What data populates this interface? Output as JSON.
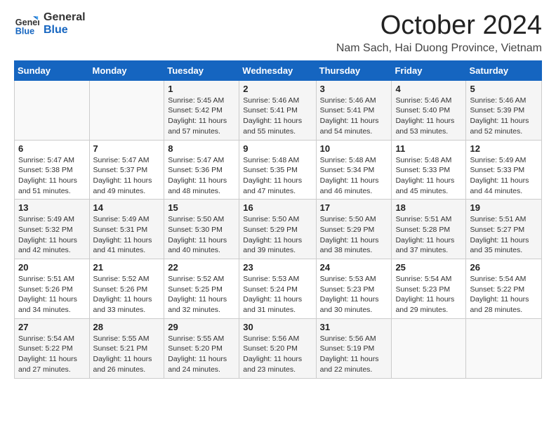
{
  "logo": {
    "line1": "General",
    "line2": "Blue"
  },
  "title": "October 2024",
  "subtitle": "Nam Sach, Hai Duong Province, Vietnam",
  "headers": [
    "Sunday",
    "Monday",
    "Tuesday",
    "Wednesday",
    "Thursday",
    "Friday",
    "Saturday"
  ],
  "weeks": [
    [
      {
        "day": "",
        "sunrise": "",
        "sunset": "",
        "daylight": ""
      },
      {
        "day": "",
        "sunrise": "",
        "sunset": "",
        "daylight": ""
      },
      {
        "day": "1",
        "sunrise": "Sunrise: 5:45 AM",
        "sunset": "Sunset: 5:42 PM",
        "daylight": "Daylight: 11 hours and 57 minutes."
      },
      {
        "day": "2",
        "sunrise": "Sunrise: 5:46 AM",
        "sunset": "Sunset: 5:41 PM",
        "daylight": "Daylight: 11 hours and 55 minutes."
      },
      {
        "day": "3",
        "sunrise": "Sunrise: 5:46 AM",
        "sunset": "Sunset: 5:41 PM",
        "daylight": "Daylight: 11 hours and 54 minutes."
      },
      {
        "day": "4",
        "sunrise": "Sunrise: 5:46 AM",
        "sunset": "Sunset: 5:40 PM",
        "daylight": "Daylight: 11 hours and 53 minutes."
      },
      {
        "day": "5",
        "sunrise": "Sunrise: 5:46 AM",
        "sunset": "Sunset: 5:39 PM",
        "daylight": "Daylight: 11 hours and 52 minutes."
      }
    ],
    [
      {
        "day": "6",
        "sunrise": "Sunrise: 5:47 AM",
        "sunset": "Sunset: 5:38 PM",
        "daylight": "Daylight: 11 hours and 51 minutes."
      },
      {
        "day": "7",
        "sunrise": "Sunrise: 5:47 AM",
        "sunset": "Sunset: 5:37 PM",
        "daylight": "Daylight: 11 hours and 49 minutes."
      },
      {
        "day": "8",
        "sunrise": "Sunrise: 5:47 AM",
        "sunset": "Sunset: 5:36 PM",
        "daylight": "Daylight: 11 hours and 48 minutes."
      },
      {
        "day": "9",
        "sunrise": "Sunrise: 5:48 AM",
        "sunset": "Sunset: 5:35 PM",
        "daylight": "Daylight: 11 hours and 47 minutes."
      },
      {
        "day": "10",
        "sunrise": "Sunrise: 5:48 AM",
        "sunset": "Sunset: 5:34 PM",
        "daylight": "Daylight: 11 hours and 46 minutes."
      },
      {
        "day": "11",
        "sunrise": "Sunrise: 5:48 AM",
        "sunset": "Sunset: 5:33 PM",
        "daylight": "Daylight: 11 hours and 45 minutes."
      },
      {
        "day": "12",
        "sunrise": "Sunrise: 5:49 AM",
        "sunset": "Sunset: 5:33 PM",
        "daylight": "Daylight: 11 hours and 44 minutes."
      }
    ],
    [
      {
        "day": "13",
        "sunrise": "Sunrise: 5:49 AM",
        "sunset": "Sunset: 5:32 PM",
        "daylight": "Daylight: 11 hours and 42 minutes."
      },
      {
        "day": "14",
        "sunrise": "Sunrise: 5:49 AM",
        "sunset": "Sunset: 5:31 PM",
        "daylight": "Daylight: 11 hours and 41 minutes."
      },
      {
        "day": "15",
        "sunrise": "Sunrise: 5:50 AM",
        "sunset": "Sunset: 5:30 PM",
        "daylight": "Daylight: 11 hours and 40 minutes."
      },
      {
        "day": "16",
        "sunrise": "Sunrise: 5:50 AM",
        "sunset": "Sunset: 5:29 PM",
        "daylight": "Daylight: 11 hours and 39 minutes."
      },
      {
        "day": "17",
        "sunrise": "Sunrise: 5:50 AM",
        "sunset": "Sunset: 5:29 PM",
        "daylight": "Daylight: 11 hours and 38 minutes."
      },
      {
        "day": "18",
        "sunrise": "Sunrise: 5:51 AM",
        "sunset": "Sunset: 5:28 PM",
        "daylight": "Daylight: 11 hours and 37 minutes."
      },
      {
        "day": "19",
        "sunrise": "Sunrise: 5:51 AM",
        "sunset": "Sunset: 5:27 PM",
        "daylight": "Daylight: 11 hours and 35 minutes."
      }
    ],
    [
      {
        "day": "20",
        "sunrise": "Sunrise: 5:51 AM",
        "sunset": "Sunset: 5:26 PM",
        "daylight": "Daylight: 11 hours and 34 minutes."
      },
      {
        "day": "21",
        "sunrise": "Sunrise: 5:52 AM",
        "sunset": "Sunset: 5:26 PM",
        "daylight": "Daylight: 11 hours and 33 minutes."
      },
      {
        "day": "22",
        "sunrise": "Sunrise: 5:52 AM",
        "sunset": "Sunset: 5:25 PM",
        "daylight": "Daylight: 11 hours and 32 minutes."
      },
      {
        "day": "23",
        "sunrise": "Sunrise: 5:53 AM",
        "sunset": "Sunset: 5:24 PM",
        "daylight": "Daylight: 11 hours and 31 minutes."
      },
      {
        "day": "24",
        "sunrise": "Sunrise: 5:53 AM",
        "sunset": "Sunset: 5:23 PM",
        "daylight": "Daylight: 11 hours and 30 minutes."
      },
      {
        "day": "25",
        "sunrise": "Sunrise: 5:54 AM",
        "sunset": "Sunset: 5:23 PM",
        "daylight": "Daylight: 11 hours and 29 minutes."
      },
      {
        "day": "26",
        "sunrise": "Sunrise: 5:54 AM",
        "sunset": "Sunset: 5:22 PM",
        "daylight": "Daylight: 11 hours and 28 minutes."
      }
    ],
    [
      {
        "day": "27",
        "sunrise": "Sunrise: 5:54 AM",
        "sunset": "Sunset: 5:22 PM",
        "daylight": "Daylight: 11 hours and 27 minutes."
      },
      {
        "day": "28",
        "sunrise": "Sunrise: 5:55 AM",
        "sunset": "Sunset: 5:21 PM",
        "daylight": "Daylight: 11 hours and 26 minutes."
      },
      {
        "day": "29",
        "sunrise": "Sunrise: 5:55 AM",
        "sunset": "Sunset: 5:20 PM",
        "daylight": "Daylight: 11 hours and 24 minutes."
      },
      {
        "day": "30",
        "sunrise": "Sunrise: 5:56 AM",
        "sunset": "Sunset: 5:20 PM",
        "daylight": "Daylight: 11 hours and 23 minutes."
      },
      {
        "day": "31",
        "sunrise": "Sunrise: 5:56 AM",
        "sunset": "Sunset: 5:19 PM",
        "daylight": "Daylight: 11 hours and 22 minutes."
      },
      {
        "day": "",
        "sunrise": "",
        "sunset": "",
        "daylight": ""
      },
      {
        "day": "",
        "sunrise": "",
        "sunset": "",
        "daylight": ""
      }
    ]
  ]
}
